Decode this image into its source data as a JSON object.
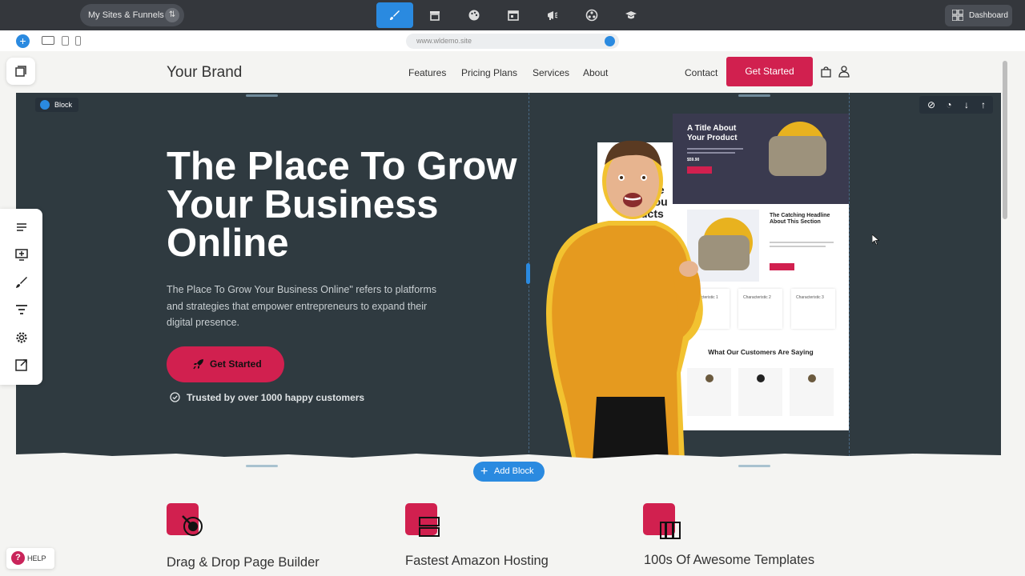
{
  "topbar": {
    "sites_label": "My Sites & Funnels",
    "dashboard_label": "Dashboard"
  },
  "urlbar": {
    "url": "www.wldemo.site"
  },
  "site": {
    "brand": "Your Brand",
    "nav": [
      "Features",
      "Pricing Plans",
      "Services",
      "About",
      "Contact"
    ],
    "cta": "Get Started"
  },
  "hero": {
    "block_label": "Block",
    "title": "The Place To Grow Your Business Online",
    "description": "The Place To Grow Your Business Online\" refers to platforms and strategies that empower entrepreneurs to expand their digital presence.",
    "cta": "Get Started",
    "trust": "Trusted by over 1000 happy customers"
  },
  "mockup": {
    "product_title": "A Title About Your Product",
    "price": "$59.90",
    "headline": "The Catching Headline About This Section",
    "partial_text": "y He\nt You\nucts",
    "characteristics": [
      "Characteristic 1",
      "Characteristic 2",
      "Characteristic 3"
    ],
    "testimonials_title": "What Our Customers Are Saying"
  },
  "editor": {
    "add_block": "Add Block",
    "help": "HELP"
  },
  "features": [
    {
      "title": "Drag & Drop Page Builder"
    },
    {
      "title": "Fastest Amazon Hosting"
    },
    {
      "title": "100s Of Awesome Templates"
    }
  ],
  "colors": {
    "accent": "#2a8ae0",
    "brand_red": "#d1204f",
    "hero_bg": "#2f3a40",
    "topbar_bg": "#34373c"
  }
}
